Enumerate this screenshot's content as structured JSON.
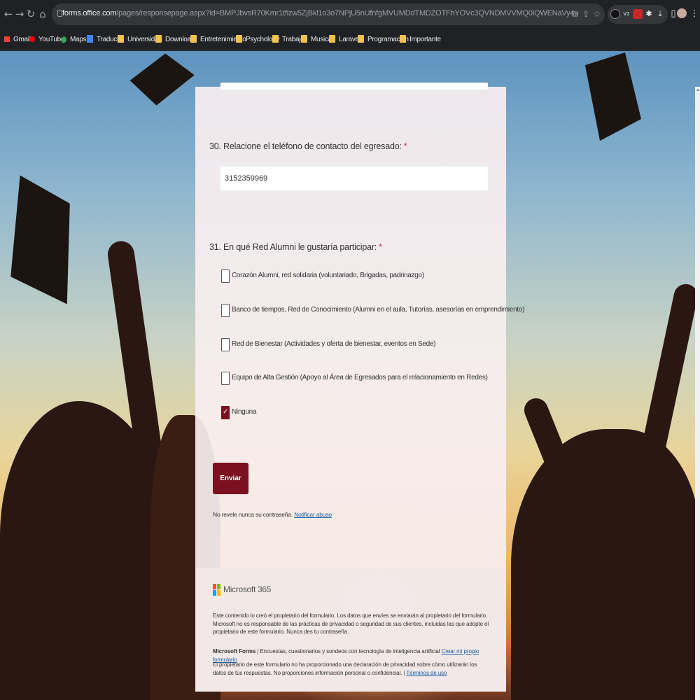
{
  "browser": {
    "url_host": "forms.office.com",
    "url_path": "/pages/responsepage.aspx?id=BMPJbvsR70Kmr1tfizw5ZjBkl1o3o7NPjU5nUfnfgMVUMDdTMDZOTFhYOVc3QVNDMVVMQ0lQWENaVy4u",
    "extension_badge": "V2",
    "bookmarks": [
      "Gmail",
      "YouTube",
      "Maps",
      "Traducir",
      "Universidad",
      "Download",
      "Entretenimiento",
      "Psychology",
      "Trabajo",
      "Musica",
      "Laravel",
      "Programacion",
      "Importante"
    ]
  },
  "form": {
    "q30": {
      "title": "30. Relacione el teléfono de contacto del egresado:",
      "required_mark": "*",
      "value": "3152359969"
    },
    "q31": {
      "title": "31. En qué Red Alumni le gustaría participar:",
      "required_mark": "*",
      "options": [
        {
          "label": "Corazón Alumni, red solidaria (voluntariado, Brigadas, padrinazgo)",
          "checked": false
        },
        {
          "label": "Banco de tiempos, Red de Conocimiento (Alumni en el aula, Tutorías, asesorías en emprendimiento)",
          "checked": false
        },
        {
          "label": "Red de Bienestar (Actividades y oferta de bienestar, eventos en Sede)",
          "checked": false
        },
        {
          "label": "Equipo de Alta Gestión (Apoyo al Área de Egresados para el relacionamiento en Redes)",
          "checked": false
        },
        {
          "label": "Ninguna",
          "checked": true
        }
      ]
    },
    "submit_label": "Enviar",
    "notice_text": "No revele nunca su contraseña.",
    "notice_link": "Notificar abuso",
    "accent_color": "#7a1020"
  },
  "footer": {
    "brand": "Microsoft 365",
    "owner_text": "Este contenido lo creó el propietario del formulario. Los datos que envíes se enviarán al propietario del formulario. Microsoft no es responsable de las prácticas de privacidad o seguridad de sus clientes, incluidas las que adopte el propietario de este formulario. Nunca des tu contraseña.",
    "forms_brand": "Microsoft Forms",
    "forms_text": "| Encuestas, cuestionarios y sondeos con tecnología de inteligencia artificial",
    "create_link": "Crear mi propio formulario",
    "privacy_text": "El propietario de este formulario no ha proporcionado una declaración de privacidad sobre cómo utilizarán los datos de tus respuestas. No proporciones información personal o confidencial. |",
    "terms_link": "Términos de uso"
  }
}
